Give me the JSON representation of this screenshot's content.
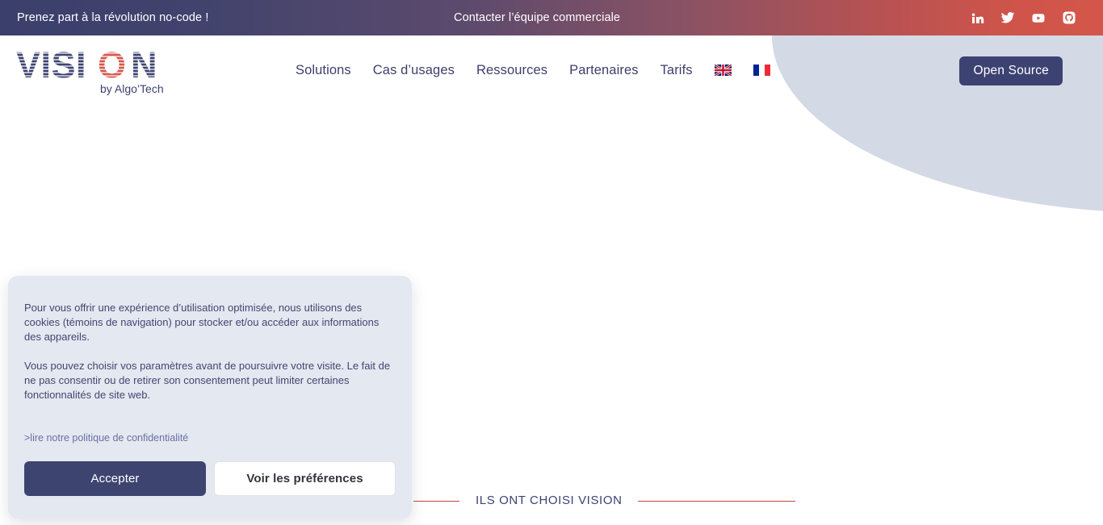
{
  "topbar": {
    "promo": "Prenez part à la révolution no-code !",
    "contact": "Contacter l’équipe commerciale",
    "socials": [
      {
        "name": "linkedin-icon",
        "label": "LinkedIn"
      },
      {
        "name": "twitter-icon",
        "label": "Twitter"
      },
      {
        "name": "youtube-icon",
        "label": "YouTube"
      },
      {
        "name": "github-icon",
        "label": "GitHub"
      }
    ],
    "gradient_from": "#3b3f6b",
    "gradient_to": "#d4564a"
  },
  "header": {
    "logo": {
      "wordmark": "VISION",
      "tagline": "by Algo’Tech",
      "wordmark_color": "#3c4272",
      "accent_color": "#d4564a"
    },
    "nav": [
      {
        "label": "Solutions"
      },
      {
        "label": "Cas d’usages"
      },
      {
        "label": "Ressources"
      },
      {
        "label": "Partenaires"
      },
      {
        "label": "Tarifs"
      }
    ],
    "languages": [
      {
        "code": "en",
        "label": "English"
      },
      {
        "code": "fr",
        "label": "Français"
      }
    ],
    "cta": {
      "label": "Open Source",
      "bg": "#3c4272"
    },
    "decor_color": "#ccd4e0"
  },
  "section_label": {
    "text": "ILS ONT CHOISI VISION",
    "rule_color": "#c0453d",
    "text_color": "#3c4272"
  },
  "cookie_banner": {
    "paragraph_1": "Pour vous offrir une expérience d’utilisation optimisée, nous utilisons des cookies (témoins de navigation) pour stocker et/ou accéder aux informations des appareils.",
    "paragraph_2": "Vous pouvez choisir vos paramètres avant de poursuivre votre visite. Le fait de ne pas consentir ou de retirer son consentement peut limiter certaines fonctionnalités de site web.",
    "policy_link": ">lire notre politique de confidentialité",
    "accept_label": "Accepter",
    "preferences_label": "Voir les préférences",
    "bg": "#e3e8f1"
  }
}
